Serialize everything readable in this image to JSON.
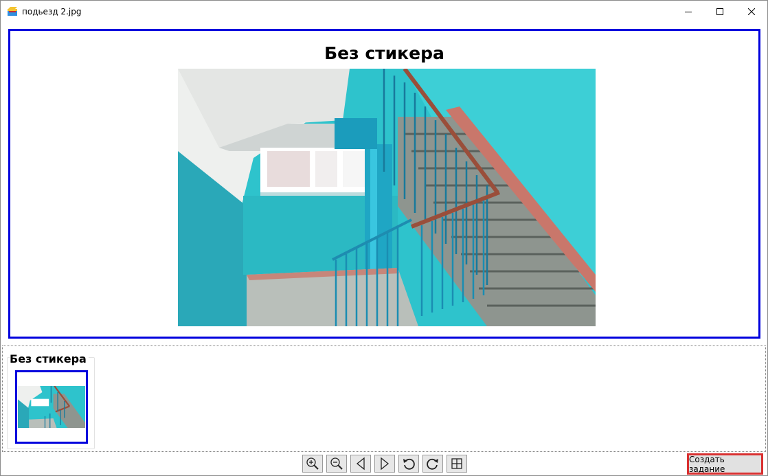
{
  "window": {
    "title": "подьезд 2.jpg"
  },
  "preview": {
    "heading": "Без стикера"
  },
  "thumbnails": {
    "group_label": "Без стикера"
  },
  "toolbar": {
    "buttons": [
      "zoom-in",
      "zoom-out",
      "previous",
      "next",
      "rotate-left",
      "rotate-right",
      "fit-window"
    ],
    "create_task_label": "Создать задание"
  },
  "colors": {
    "selection_border": "#0000dd",
    "highlight_border": "#d93030",
    "wall_teal": "#2bbfc8"
  }
}
